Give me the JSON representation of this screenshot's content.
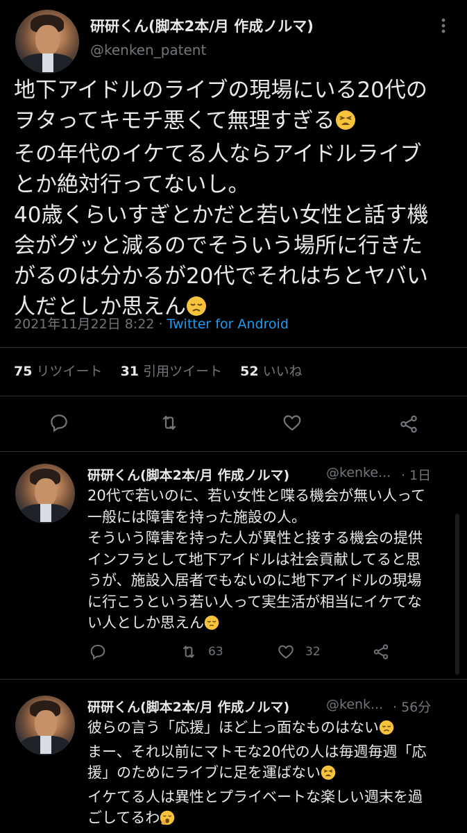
{
  "main_tweet": {
    "author_name": "研研くん(脚本2本/月 作成ノルマ)",
    "author_handle": "@kenken_patent",
    "more_icon": "ellipsis-icon",
    "text": "地下アイドルのライブの現場にいる20代の\nヲタってキモチ悪くて無理すぎる",
    "text_emoji_1": "tired-face-emoji",
    "text_2": "\nその年代のイケてる人ならアイドルライブ\nとか絶対行ってないし。\n40歳くらいすぎとかだと若い女性と話す機\n会がグッと減るのでそういう場所に行きた\nがるのは分かるが20代でそれはちとヤバい\n人だとしか思えん",
    "text_emoji_2": "disappointed-face-emoji",
    "timestamp": "2021年11月22日 8:22",
    "separator": " · ",
    "source": "Twitter for Android",
    "retweets_count": "75",
    "retweets_label": "リツイート",
    "quotes_count": "31",
    "quotes_label": "引用ツイート",
    "likes_count": "52",
    "likes_label": "いいね"
  },
  "replies": [
    {
      "author_name": "研研くん(脚本2本/月 作成ノルマ)",
      "author_handle": "@kenke...",
      "time": "· 1日",
      "text": "20代で若いのに、若い女性と喋る機会が無い人って\n一般には障害を持った施設の人。\nそういう障害を持った人が異性と接する機会の提供\nインフラとして地下アイドルは社会貢献してると思\nうが、施設入居者でもないのに地下アイドルの現場\nに行こうという若い人って実生活が相当にイケてな\nい人としか思えん",
      "emoji": "pensive-face-emoji",
      "retweets": "63",
      "likes": "32"
    },
    {
      "author_name": "研研くん(脚本2本/月 作成ノルマ)",
      "author_handle": "@kenk...",
      "time": "· 56分",
      "text_a": "彼らの言う「応援」ほど上っ面なものはない",
      "emoji_a": "disappointed-face-emoji",
      "text_b": "\nまー、それ以前にマトモな20代の人は毎週毎週「応\n援」のためにライブに足を運ばない",
      "emoji_b": "tired-face-emoji",
      "text_c": "\nイケてる人は異性とプライベートな楽しい週末を過\nごしてるわ",
      "emoji_c": "yawning-face-emoji"
    }
  ],
  "colors": {
    "background": "#000000",
    "text": "#e7e9ea",
    "muted": "#71767b",
    "link": "#1d9bf0",
    "divider": "#2f3336",
    "emoji": "#f7c23c"
  }
}
